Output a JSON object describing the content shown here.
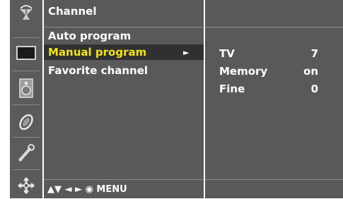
{
  "colors": {
    "panel": "#595959",
    "selected_bg": "#303030",
    "selected_text": "#f2e414",
    "text": "#ffffff"
  },
  "sidebar": {
    "icons": [
      "satellite-dish-icon",
      "screen-icon",
      "speaker-icon",
      "clock-icon",
      "wrench-icon",
      "settings-icon"
    ],
    "selected": "satellite-dish-icon"
  },
  "menu": {
    "title": "Channel",
    "items": [
      {
        "label": "Auto program"
      },
      {
        "label": "Manual program",
        "arrow": "►"
      },
      {
        "label": "Favorite channel"
      }
    ],
    "selected_index": 1,
    "footer": "▲▼ ◄ ► ◉ MENU"
  },
  "info": {
    "rows": [
      {
        "key": "TV",
        "value": "7"
      },
      {
        "key": "Memory",
        "value": "on"
      },
      {
        "key": "Fine",
        "value": "0"
      }
    ]
  }
}
